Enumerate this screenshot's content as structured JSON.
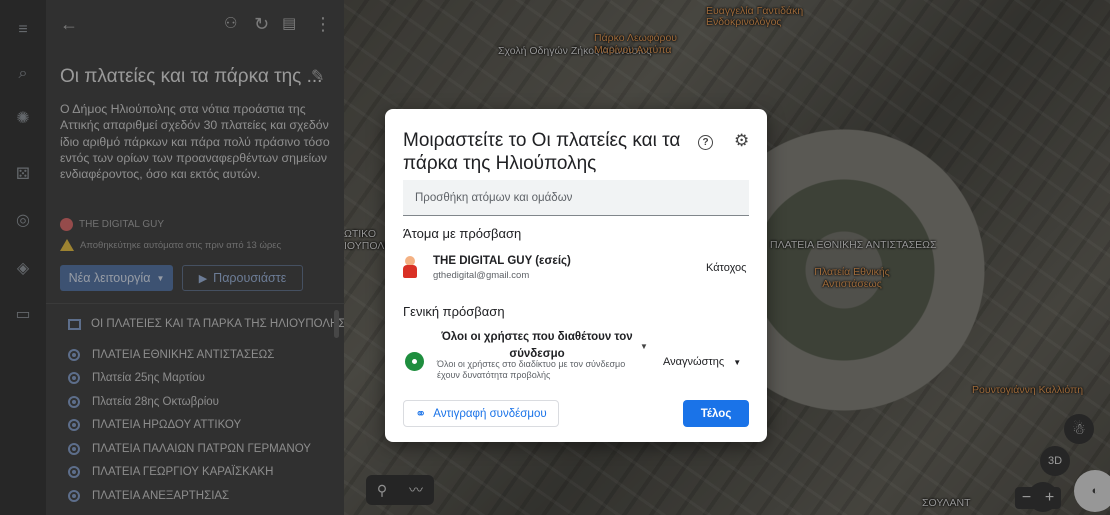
{
  "panel": {
    "title": "Οι πλατείες και τα πάρκα της ...",
    "description": "Ο Δήμος Ηλιούπολης στα νότια προάστια της Αττικής απαριθμεί σχεδόν 30 πλατείες και σχεδόν ίδιο αριθμό πάρκων και πάρα πολύ πράσινο τόσο εντός των ορίων των προαναφερθέντων σημείων ενδιαφέροντος, όσο και εκτός αυτών.",
    "author": "THE DIGITAL GUY",
    "saved_status": "Αποθηκεύτηκε αυτόματα στις πριν από 13 ώρες",
    "new_feature_label": "Νέα λειτουργία",
    "present_label": "Παρουσιάστε",
    "layer_title": "ΟΙ ΠΛΑΤΕΙΕΣ ΚΑΙ ΤΑ ΠΑΡΚΑ ΤΗΣ ΗΛΙΟΥΠΟΛΗΣ Τ...",
    "places": [
      "ΠΛΑΤΕΙΑ ΕΘΝΙΚΗΣ ΑΝΤΙΣΤΑΣΕΩΣ",
      "Πλατεία 25ης Μαρτίου",
      "Πλατεία 28ης Οκτωβρίου",
      "ΠΛΑΤΕΙΑ ΗΡΩΔΟΥ ΑΤΤΙΚΟΥ",
      "ΠΛΑΤΕΙΑ ΠΑΛΑΙΩΝ ΠΑΤΡΩΝ ΓΕΡΜΑΝΟΥ",
      "ΠΛΑΤΕΙΑ ΓΕΩΡΓΙΟΥ ΚΑΡΑΪΣΚΑΚΗ",
      "ΠΛΑΤΕΙΑ ΑΝΕΞΑΡΤΗΣΙΑΣ"
    ]
  },
  "map": {
    "labels": [
      "Σχολή Οδηγών Ζήκος Αθανάσιος",
      "Πάρκο Λεωφόρου Μαρίνου Αντύπα",
      "Ευαγγελία Γαντιδάκη Ενδοκρινολόγος",
      "ΠΛΑΤΕΙΑ ΕΘΝΙΚΗΣ ΑΝΤΙΣΤΑΣΕΩΣ",
      "Πλατεία Εθνικής Αντιστάσεως",
      "Ρουντογιάννη Καλλιόπη",
      "ΣΟΥΛΑΝΤ"
    ],
    "cut_labels": [
      "ΩΤΙΚΟ",
      "ΙΟΥΠΟΛΗ"
    ],
    "btn_3d": "3D"
  },
  "dialog": {
    "title": "Μοιραστείτε το Οι πλατείες και τα πάρκα της Ηλιούπολης",
    "add_placeholder": "Προσθήκη ατόμων και ομάδων",
    "access_heading": "Άτομα με πρόσβαση",
    "user_name": "THE DIGITAL GUY (εσείς)",
    "user_email": "gthedigital@gmail.com",
    "user_role": "Κάτοχος",
    "general_heading": "Γενική πρόσβαση",
    "general_option": "Όλοι οι χρήστες που διαθέτουν τον σύνδεσμο",
    "general_desc": "Όλοι οι χρήστες στο διαδίκτυο με τον σύνδεσμο έχουν δυνατότητα προβολής",
    "general_role": "Αναγνώστης",
    "copy_link": "Αντιγραφή συνδέσμου",
    "done": "Τέλος"
  }
}
